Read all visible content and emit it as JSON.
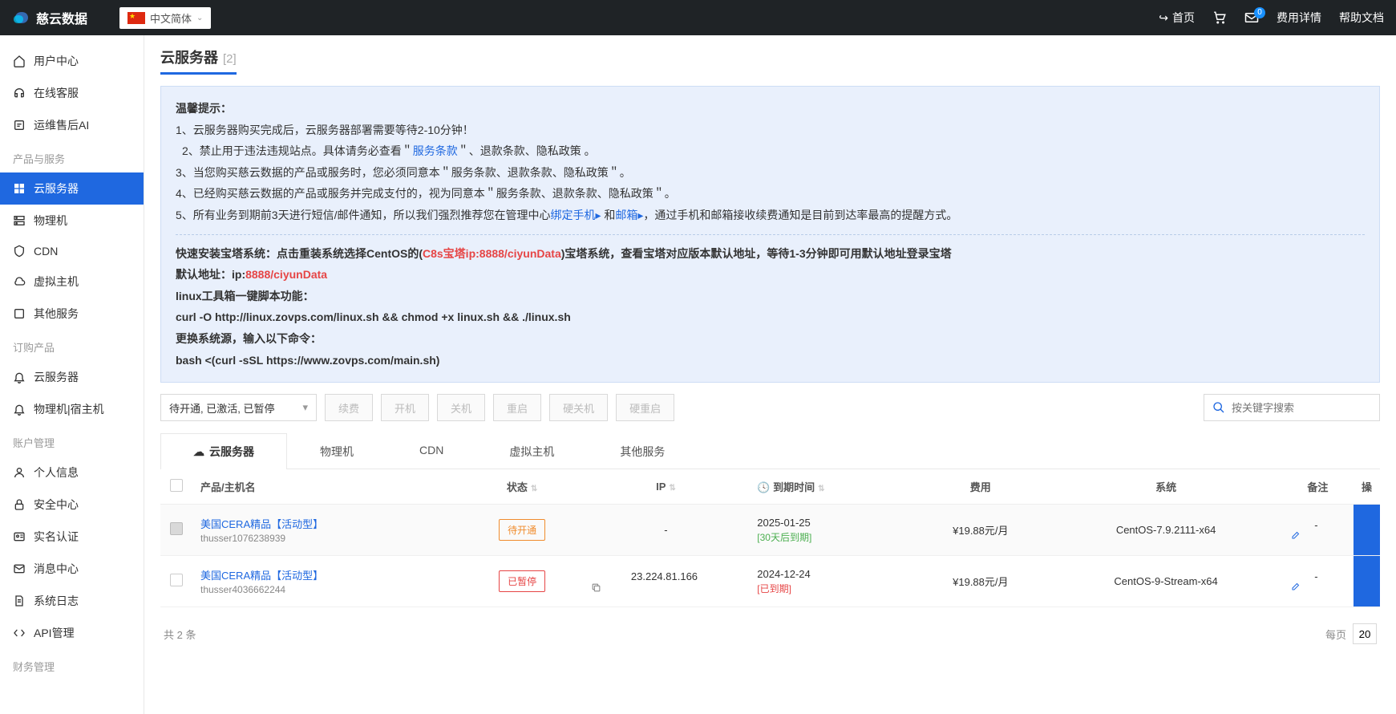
{
  "header": {
    "brand": "慈云数据",
    "lang": "中文简体",
    "home_label": "首页",
    "badge_count": "0",
    "fee_detail": "费用详情",
    "help_doc": "帮助文档"
  },
  "sidebar": {
    "items_top": [
      {
        "icon": "home",
        "label": "用户中心"
      },
      {
        "icon": "headset",
        "label": "在线客服"
      },
      {
        "icon": "ai",
        "label": "运维售后AI"
      }
    ],
    "group_product": "产品与服务",
    "items_product": [
      {
        "icon": "grid",
        "label": "云服务器",
        "active": true
      },
      {
        "icon": "server",
        "label": "物理机"
      },
      {
        "icon": "shield",
        "label": "CDN"
      },
      {
        "icon": "cloud",
        "label": "虚拟主机"
      },
      {
        "icon": "box",
        "label": "其他服务"
      }
    ],
    "group_order": "订购产品",
    "items_order": [
      {
        "icon": "bell",
        "label": "云服务器"
      },
      {
        "icon": "bell",
        "label": "物理机|宿主机"
      }
    ],
    "group_account": "账户管理",
    "items_account": [
      {
        "icon": "user",
        "label": "个人信息"
      },
      {
        "icon": "lock",
        "label": "安全中心"
      },
      {
        "icon": "id",
        "label": "实名认证"
      },
      {
        "icon": "mail",
        "label": "消息中心"
      },
      {
        "icon": "log",
        "label": "系统日志"
      },
      {
        "icon": "api",
        "label": "API管理"
      }
    ],
    "group_finance": "财务管理"
  },
  "page": {
    "title": "云服务器",
    "count": "[2]"
  },
  "notice": {
    "heading": "温馨提示：",
    "line1": "1、云服务器购买完成后，云服务器部署需要等待2-10分钟！",
    "line2_a": "2、禁止用于违法违规站点。具体请务必查看＂",
    "line2_link1": "服务条款",
    "line2_b": "＂、退款条款、隐私政策 。",
    "line3": "3、当您购买慈云数据的产品或服务时，您必须同意本＂服务条款、退款条款、隐私政策＂。",
    "line4": "4、已经购买慈云数据的产品或服务并完成支付的，视为同意本＂服务条款、退款条款、隐私政策＂。",
    "line5_a": "5、所有业务到期前3天进行短信/邮件通知，所以我们强烈推荐您在管理中心",
    "line5_link_phone": "绑定手机",
    "line5_arrow1": "▸",
    "line5_and": " 和",
    "line5_link_mail": "邮箱",
    "line5_arrow2": "▸",
    "line5_b": "，通过手机和邮箱接收续费通知是目前到达率最高的提醒方式。",
    "bt_a": "快速安装宝塔系统：点击重装系统选择CentOS的(",
    "bt_red": "C8s宝塔ip:8888/ciyunData",
    "bt_b": ")宝塔系统，查看宝塔对应版本默认地址，等待1-3分钟即可用默认地址登录宝塔",
    "default_addr_a": "默认地址：ip:",
    "default_addr_red": "8888/ciyunData",
    "linux_tool": "linux工具箱一键脚本功能：",
    "curl_cmd": "curl -O http://linux.zovps.com/linux.sh && chmod +x linux.sh && ./linux.sh",
    "change_src": "更换系统源，输入以下命令：",
    "bash_cmd": "bash <(curl -sSL https://www.zovps.com/main.sh)"
  },
  "toolbar": {
    "status_value": "待开通, 已激活, 已暂停",
    "btn_renew": "续费",
    "btn_start": "开机",
    "btn_stop": "关机",
    "btn_restart": "重启",
    "btn_hardstop": "硬关机",
    "btn_hardrestart": "硬重启",
    "search_placeholder": "按关键字搜索"
  },
  "tabs": [
    {
      "label": "云服务器",
      "active": true
    },
    {
      "label": "物理机"
    },
    {
      "label": "CDN"
    },
    {
      "label": "虚拟主机"
    },
    {
      "label": "其他服务"
    }
  ],
  "table": {
    "headers": {
      "product": "产品/主机名",
      "status": "状态",
      "ip": "IP",
      "expiry": "到期时间",
      "fee": "费用",
      "system": "系统",
      "remark": "备注",
      "action": "操"
    },
    "rows": [
      {
        "checked": true,
        "product": "美国CERA精品【活动型】",
        "host": "thusser1076238939",
        "status": "待开通",
        "status_class": "pending",
        "ip": "-",
        "has_copy": false,
        "expiry": "2025-01-25",
        "expiry_sub": "[30天后到期]",
        "expiry_class": "green",
        "fee": "¥19.88元/月",
        "system": "CentOS-7.9.2111-x64",
        "remark": "-"
      },
      {
        "checked": false,
        "product": "美国CERA精品【活动型】",
        "host": "thusser4036662244",
        "status": "已暂停",
        "status_class": "paused",
        "ip": "23.224.81.166",
        "has_copy": true,
        "expiry": "2024-12-24",
        "expiry_sub": "[已到期]",
        "expiry_class": "red",
        "fee": "¥19.88元/月",
        "system": "CentOS-9-Stream-x64",
        "remark": "-"
      }
    ],
    "footer_total": "共 2 条",
    "footer_per_page_label": "每页",
    "footer_per_page_value": "20"
  }
}
